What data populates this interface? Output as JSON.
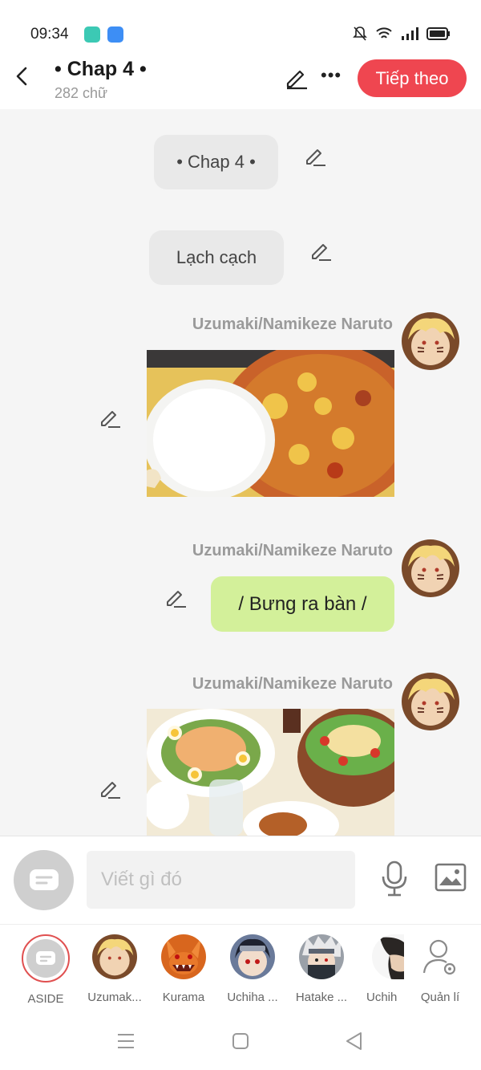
{
  "status_bar": {
    "time": "09:34"
  },
  "header": {
    "title": "• Chap 4 •",
    "subtitle": "282 chữ",
    "next_label": "Tiếp theo"
  },
  "messages": [
    {
      "type": "system",
      "text": "• Chap 4 •"
    },
    {
      "type": "system",
      "text": "Lạch cạch"
    },
    {
      "type": "image",
      "sender": "Uzumaki/Namikeze Naruto"
    },
    {
      "type": "text",
      "sender": "Uzumaki/Namikeze Naruto",
      "text": "/ Bưng ra bàn /"
    },
    {
      "type": "image",
      "sender": "Uzumaki/Namikeze Naruto"
    }
  ],
  "input": {
    "placeholder": "Viết gì đó"
  },
  "characters": [
    {
      "label": "ASIDE"
    },
    {
      "label": "Uzumak..."
    },
    {
      "label": "Kurama"
    },
    {
      "label": "Uchiha ..."
    },
    {
      "label": "Hatake ..."
    },
    {
      "label": "Uchih"
    },
    {
      "label": "Quản lí"
    }
  ],
  "colors": {
    "accent": "#ef4650",
    "bubble_green": "#d3f09a",
    "chat_bg": "#f5f5f5"
  },
  "icons": [
    "back-icon",
    "edit-icon",
    "more-icon",
    "pencil-icon",
    "mic-icon",
    "image-icon",
    "manage-icon",
    "menu-icon",
    "home-icon",
    "back-nav-icon"
  ]
}
